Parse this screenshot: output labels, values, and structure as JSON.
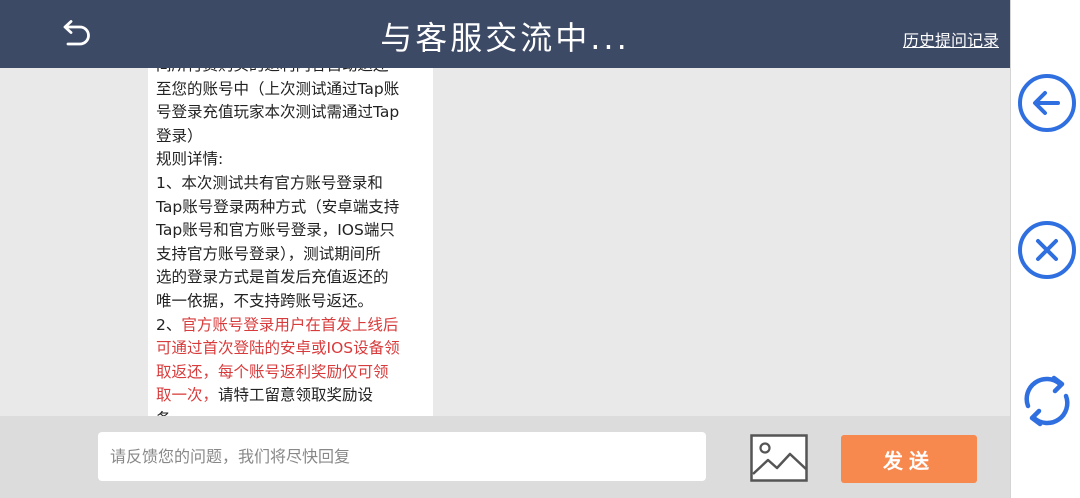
{
  "header": {
    "title": "与客服交流中...",
    "history_link": "历史提问记录"
  },
  "message": {
    "lines": [
      "间所付费购买的返利内容自动返还",
      "至您的账号中（上次测试通过Tap账",
      "号登录充值玩家本次测试需通过Tap",
      "登录）",
      " 规则详情:",
      "1、本次测试共有官方账号登录和",
      "Tap账号登录两种方式（安卓端支持",
      "Tap账号和官方账号登录，IOS端只",
      "支持官方账号登录），测试期间所",
      "选的登录方式是首发后充值返还的",
      "唯一依据，不支持跨账号返还。"
    ],
    "item2_prefix": "2、",
    "item2_red_1": "官方账号登录用户在首发上线后",
    "item2_red_2": "可通过首次登陆的安卓或IOS设备领",
    "item2_red_3": "取返还，每个账号返利奖励仅可领",
    "item2_red_4": "取一次，",
    "item2_tail_1": "请特工留意领取奖励设",
    "item2_tail_2": "备。"
  },
  "input": {
    "placeholder": "请反馈您的问题，我们将尽快回复",
    "value": ""
  },
  "send_label": "发送",
  "colors": {
    "header_bg": "#3d4a66",
    "accent_blue": "#2f6fe0",
    "send_orange": "#f7894f",
    "highlight_red": "#d83b3b"
  },
  "icons": {
    "back": "undo-arrow-icon",
    "image": "image-icon",
    "side_back": "arrow-left-circle-icon",
    "side_close": "close-circle-icon",
    "side_refresh": "refresh-icon"
  }
}
